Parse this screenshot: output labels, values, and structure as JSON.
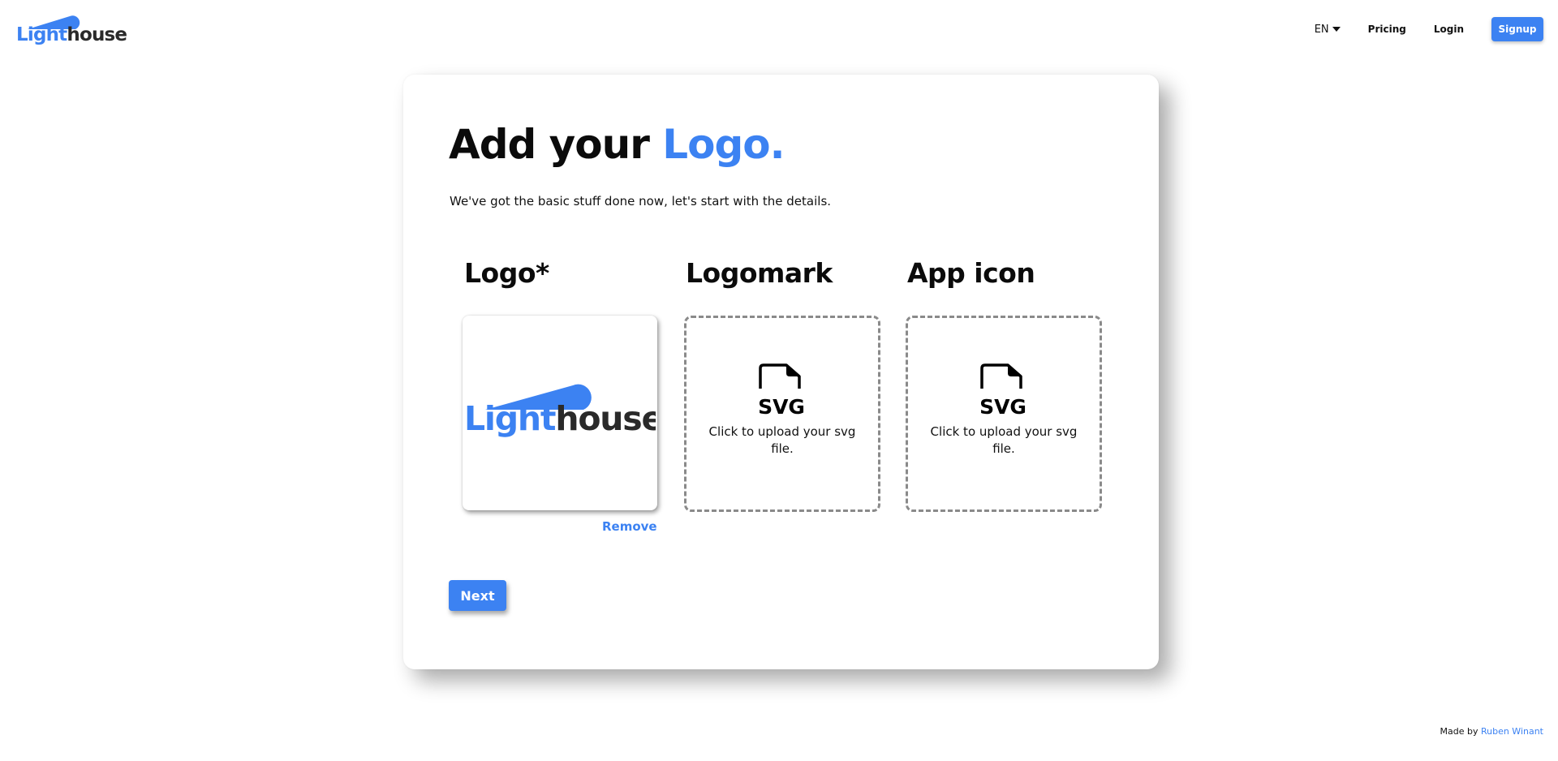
{
  "header": {
    "brand_light": "Light",
    "brand_house": "house",
    "language": "EN",
    "pricing_label": "Pricing",
    "login_label": "Login",
    "signup_label": "Signup"
  },
  "main": {
    "title_prefix": "Add your ",
    "title_accent": "Logo.",
    "subtitle": "We've got the basic stuff done now, let's start with the details.",
    "columns": [
      {
        "title": "Logo*",
        "preview": {
          "light": "Light",
          "house": "house"
        },
        "remove_label": "Remove"
      },
      {
        "title": "Logomark",
        "upload_text": "Click to upload your svg file.",
        "icon_label": "SVG"
      },
      {
        "title": "App icon",
        "upload_text": "Click to upload your svg file.",
        "icon_label": "SVG"
      }
    ],
    "next_label": "Next"
  },
  "footer": {
    "made_by": "Made by",
    "author": "Ruben Winant"
  },
  "colors": {
    "accent": "#3c82f2",
    "text": "#111111",
    "dashed_border": "#8a8a8a",
    "brand_dark": "#2a2a2a"
  },
  "icons": {
    "language_caret": "chevron-down-icon",
    "upload": "svg-file-icon"
  }
}
